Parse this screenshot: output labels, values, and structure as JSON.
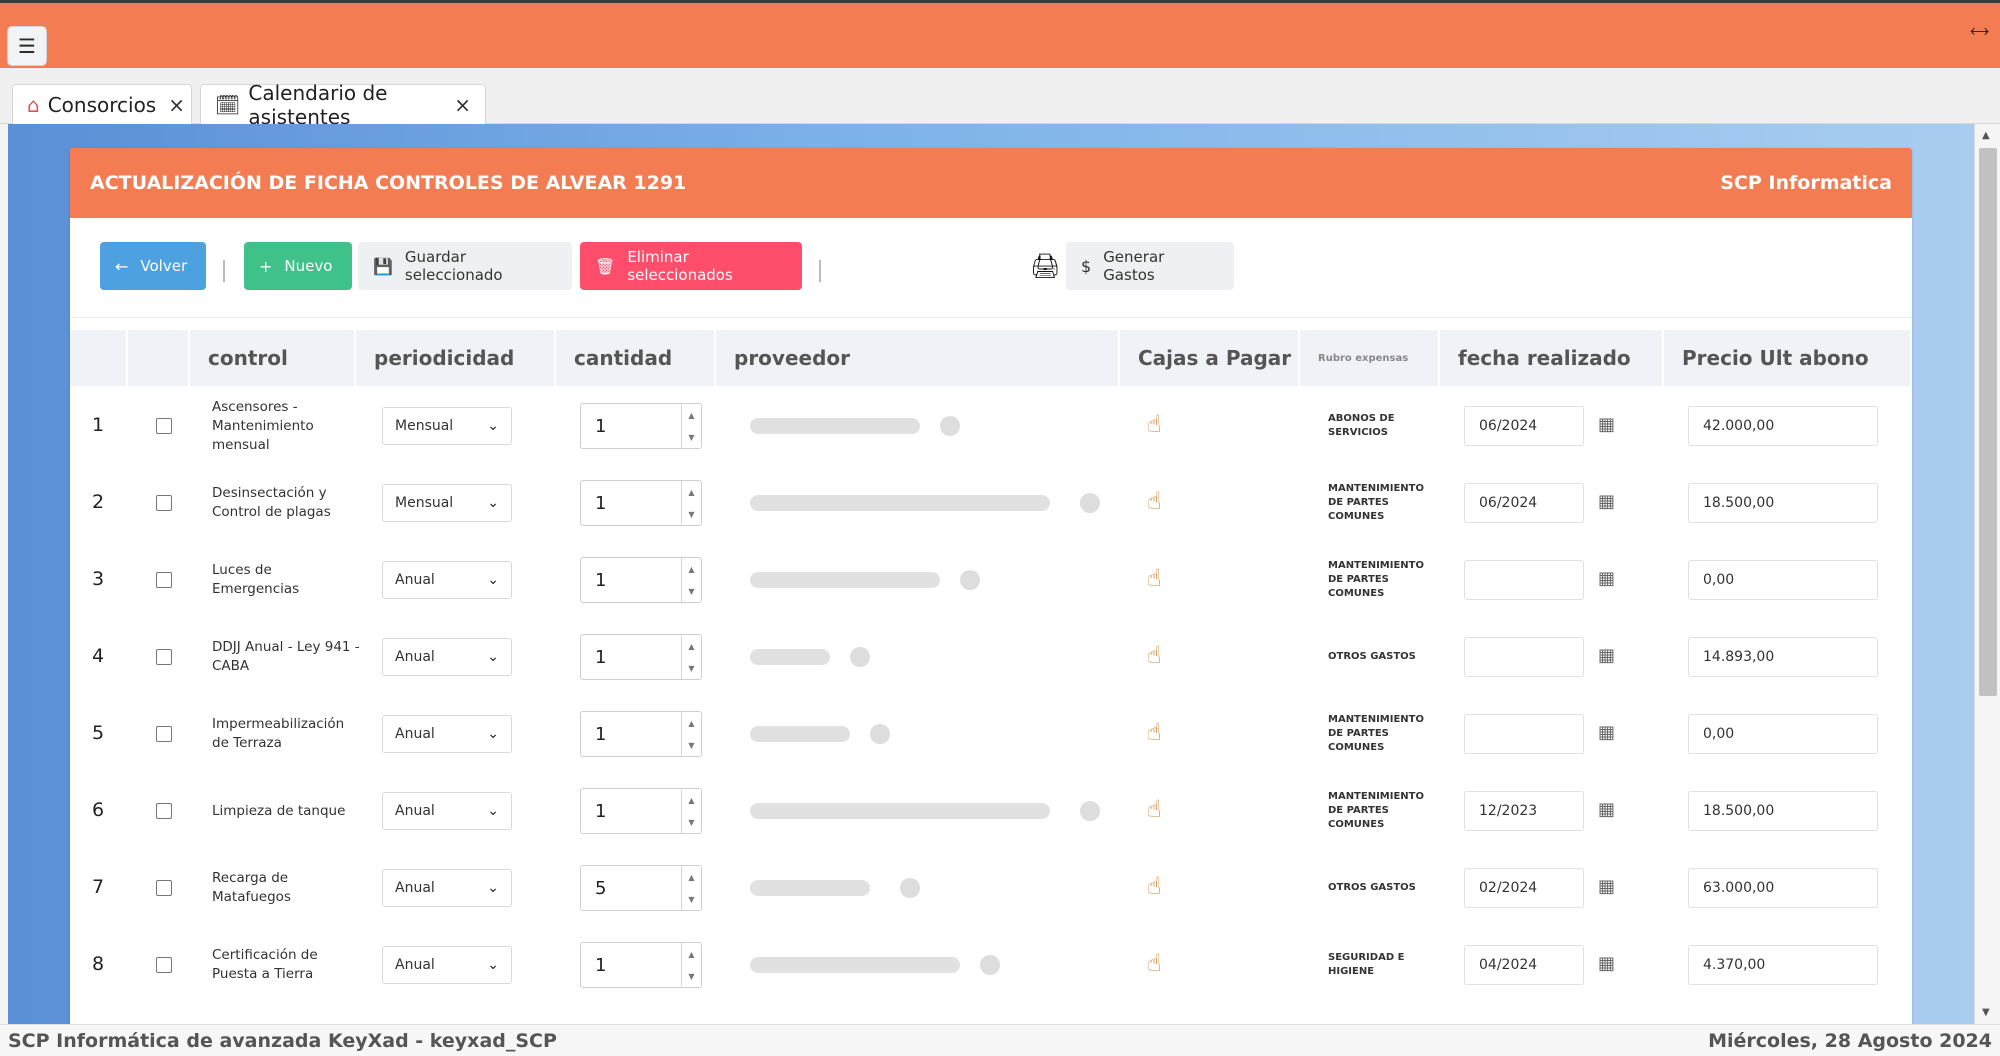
{
  "topbar": {
    "menu_icon": "hamburger-icon",
    "expand_icon": "expand-icon"
  },
  "tabs": [
    {
      "label": "Consorcios",
      "icon": "home-icon",
      "close": "×"
    },
    {
      "label": "Calendario de asistentes",
      "icon": "calendar-check-icon",
      "close": "×"
    }
  ],
  "panel": {
    "title": "ACTUALIZACIÓN DE FICHA CONTROLES DE ALVEAR 1291",
    "brand": "SCP Informatica",
    "toolbar": {
      "volver": "Volver",
      "nuevo": "Nuevo",
      "guardar": "Guardar seleccionado",
      "eliminar": "Eliminar seleccionados",
      "gastos": "Generar Gastos"
    },
    "columns": [
      "control",
      "periodicidad",
      "cantidad",
      "proveedor",
      "Cajas a Pagar",
      "Rubro expensas",
      "fecha realizado",
      "Precio Ult abono"
    ],
    "rows": [
      {
        "n": "1",
        "control": "Ascensores - Mantenimiento mensual",
        "periodicidad": "Mensual",
        "cantidad": "1",
        "rubro": "ABONOS DE SERVICIOS",
        "fecha": "06/2024",
        "precio": "42.000,00"
      },
      {
        "n": "2",
        "control": "Desinsectación y Control de plagas",
        "periodicidad": "Mensual",
        "cantidad": "1",
        "rubro": "MANTENIMIENTO DE PARTES COMUNES",
        "fecha": "06/2024",
        "precio": "18.500,00"
      },
      {
        "n": "3",
        "control": "Luces de Emergencias",
        "periodicidad": "Anual",
        "cantidad": "1",
        "rubro": "MANTENIMIENTO DE PARTES COMUNES",
        "fecha": "",
        "precio": "0,00"
      },
      {
        "n": "4",
        "control": "DDJJ Anual - Ley 941 - CABA",
        "periodicidad": "Anual",
        "cantidad": "1",
        "rubro": "OTROS GASTOS",
        "fecha": "",
        "precio": "14.893,00"
      },
      {
        "n": "5",
        "control": "Impermeabilización de Terraza",
        "periodicidad": "Anual",
        "cantidad": "1",
        "rubro": "MANTENIMIENTO DE PARTES COMUNES",
        "fecha": "",
        "precio": "0,00"
      },
      {
        "n": "6",
        "control": "Limpieza de tanque",
        "periodicidad": "Anual",
        "cantidad": "1",
        "rubro": "MANTENIMIENTO DE PARTES COMUNES",
        "fecha": "12/2023",
        "precio": "18.500,00"
      },
      {
        "n": "7",
        "control": "Recarga de Matafuegos",
        "periodicidad": "Anual",
        "cantidad": "5",
        "rubro": "OTROS GASTOS",
        "fecha": "02/2024",
        "precio": "63.000,00"
      },
      {
        "n": "8",
        "control": "Certificación de Puesta a Tierra",
        "periodicidad": "Anual",
        "cantidad": "1",
        "rubro": "SEGURIDAD E HIGIENE",
        "fecha": "04/2024",
        "precio": "4.370,00"
      }
    ]
  },
  "statusbar": {
    "left": "SCP Informática de avanzada KeyXad - keyxad_SCP",
    "right": "Miércoles, 28 Agosto 2024"
  }
}
